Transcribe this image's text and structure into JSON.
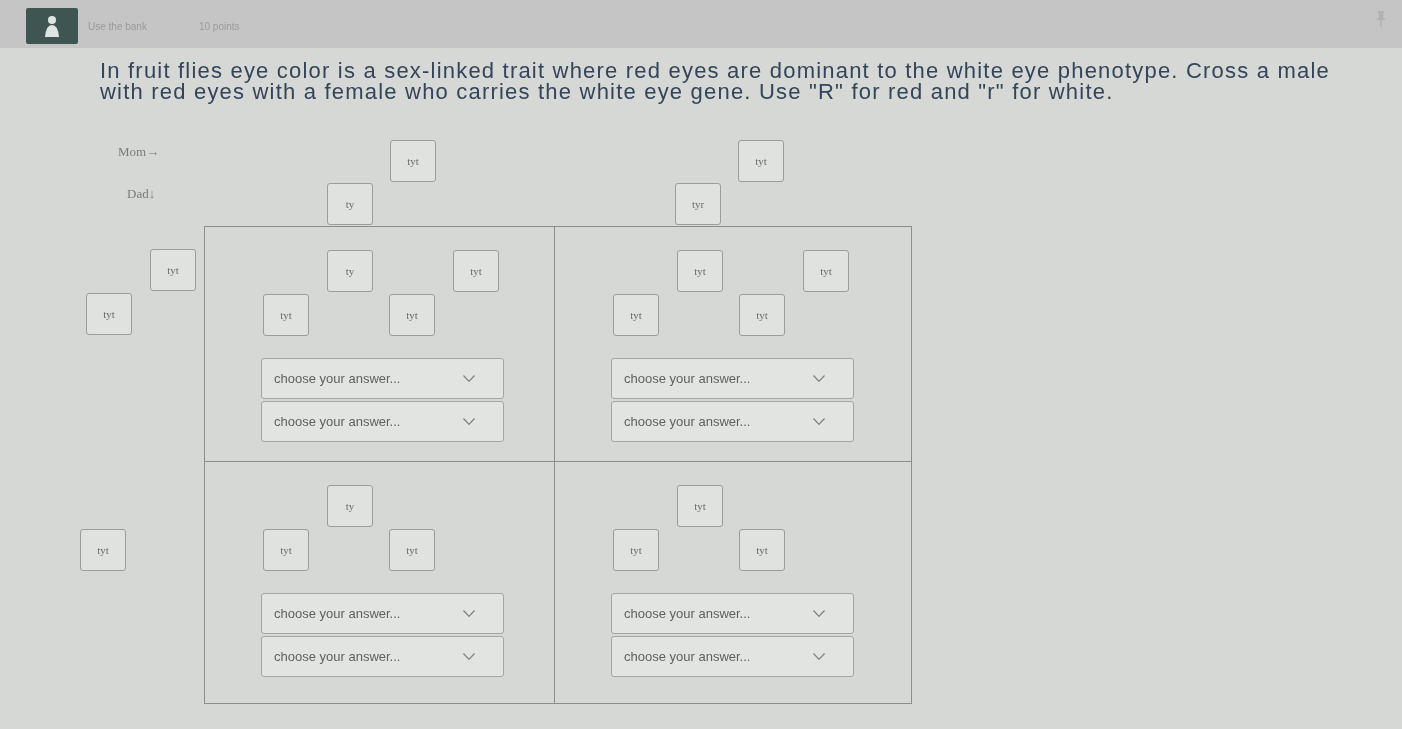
{
  "header": {
    "title": "Use the bank",
    "points": "10 points"
  },
  "question": "In fruit flies eye color is a sex-linked trait where red eyes are dominant to the white eye phenotype. Cross a male with red eyes with a female who carries the white eye gene. Use \"R\" for red and \"r\" for white.",
  "punnett": {
    "mom": {
      "label": "Mom→",
      "tiles": [
        "tyt",
        "tyt"
      ]
    },
    "dad": {
      "label": "Dad↓",
      "tiles": [
        "ty",
        "tyr"
      ]
    },
    "rows": [
      {
        "side": {
          "upper": "tyt",
          "lower": "tyt"
        },
        "cells": [
          {
            "upper_tiles": [
              "ty",
              "tyt"
            ],
            "lower_tiles": [
              "tyt",
              "tyt"
            ],
            "dropdowns": [
              {
                "placeholder": "choose your answer..."
              },
              {
                "placeholder": "choose your answer..."
              }
            ]
          },
          {
            "upper_tiles": [
              "tyt",
              "tyt"
            ],
            "lower_tiles": [
              "tyt",
              "tyt"
            ],
            "dropdowns": [
              {
                "placeholder": "choose your answer..."
              },
              {
                "placeholder": "choose your answer..."
              }
            ]
          }
        ]
      },
      {
        "side": {
          "lower": "tyt"
        },
        "cells": [
          {
            "upper_tiles": [
              "ty"
            ],
            "lower_tiles": [
              "tyt",
              "tyt"
            ],
            "dropdowns": [
              {
                "placeholder": "choose your answer..."
              },
              {
                "placeholder": "choose your answer..."
              }
            ]
          },
          {
            "upper_tiles": [
              "tyt"
            ],
            "lower_tiles": [
              "tyt",
              "tyt"
            ],
            "dropdowns": [
              {
                "placeholder": "choose your answer..."
              },
              {
                "placeholder": "choose your answer..."
              }
            ]
          }
        ]
      }
    ]
  }
}
